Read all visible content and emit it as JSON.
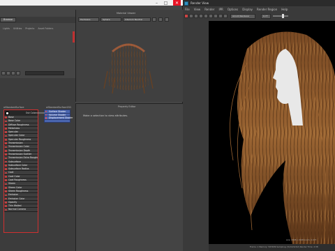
{
  "left_window": {
    "panel_tab": "Browse",
    "sub_tabs": [
      "Lights",
      "Utilities",
      "Projects",
      "Asset Folders"
    ],
    "search_placeholder": ""
  },
  "shading_network": {
    "node_title": "aiStandardSurface",
    "out_color_label": "Out Color",
    "attributes": [
      "Base",
      "Base Color",
      "Diffuse Roughness",
      "Metalness",
      "Specular",
      "Specular Color",
      "Specular Roughness",
      "Transmission",
      "Transmission Color",
      "Transmission Depth",
      "Transmission Scatter",
      "Transmission Extra Roughness",
      "Subsurface",
      "Subsurface Color",
      "Subsurface Radius",
      "Coat",
      "Coat Color",
      "Coat Roughness",
      "Sheen",
      "Sheen Color",
      "Sheen Roughness",
      "Emission",
      "Emission Color",
      "Opacity",
      "Thin Walled",
      "Normal Camera"
    ],
    "shading_group_title": "aiStandardSurface1SG",
    "shading_group_slots": [
      "Surface Shader",
      "Volume Shader",
      "Displacement Shader"
    ]
  },
  "material_viewer": {
    "title": "Material Viewer",
    "renderer": "Hardware",
    "shape": "Sphere",
    "env": "Interior1 Neutral"
  },
  "property_editor": {
    "title": "Property Editor",
    "message": "Make a selection to view attributes."
  },
  "render_view": {
    "window_title": "Render View",
    "menu": [
      "File",
      "View",
      "Render",
      "IPR",
      "Options",
      "Display",
      "Render Region",
      "Help"
    ],
    "camera": "persp",
    "render_preset": "Arnold Renderer",
    "exposure": "0.77",
    "status_left": "size: 2048 x 2048  zoom: 0.473",
    "status_right": "Frame: 1   Memory: 5974Mb   Sampling: [5/2/2/2/2/2]   Render Time: 2:38"
  },
  "colors": {
    "accent_red": "#d03030",
    "sg_blue": "#4b66b0",
    "hair": "#8a5a2a",
    "face": "#e8e8e8"
  }
}
